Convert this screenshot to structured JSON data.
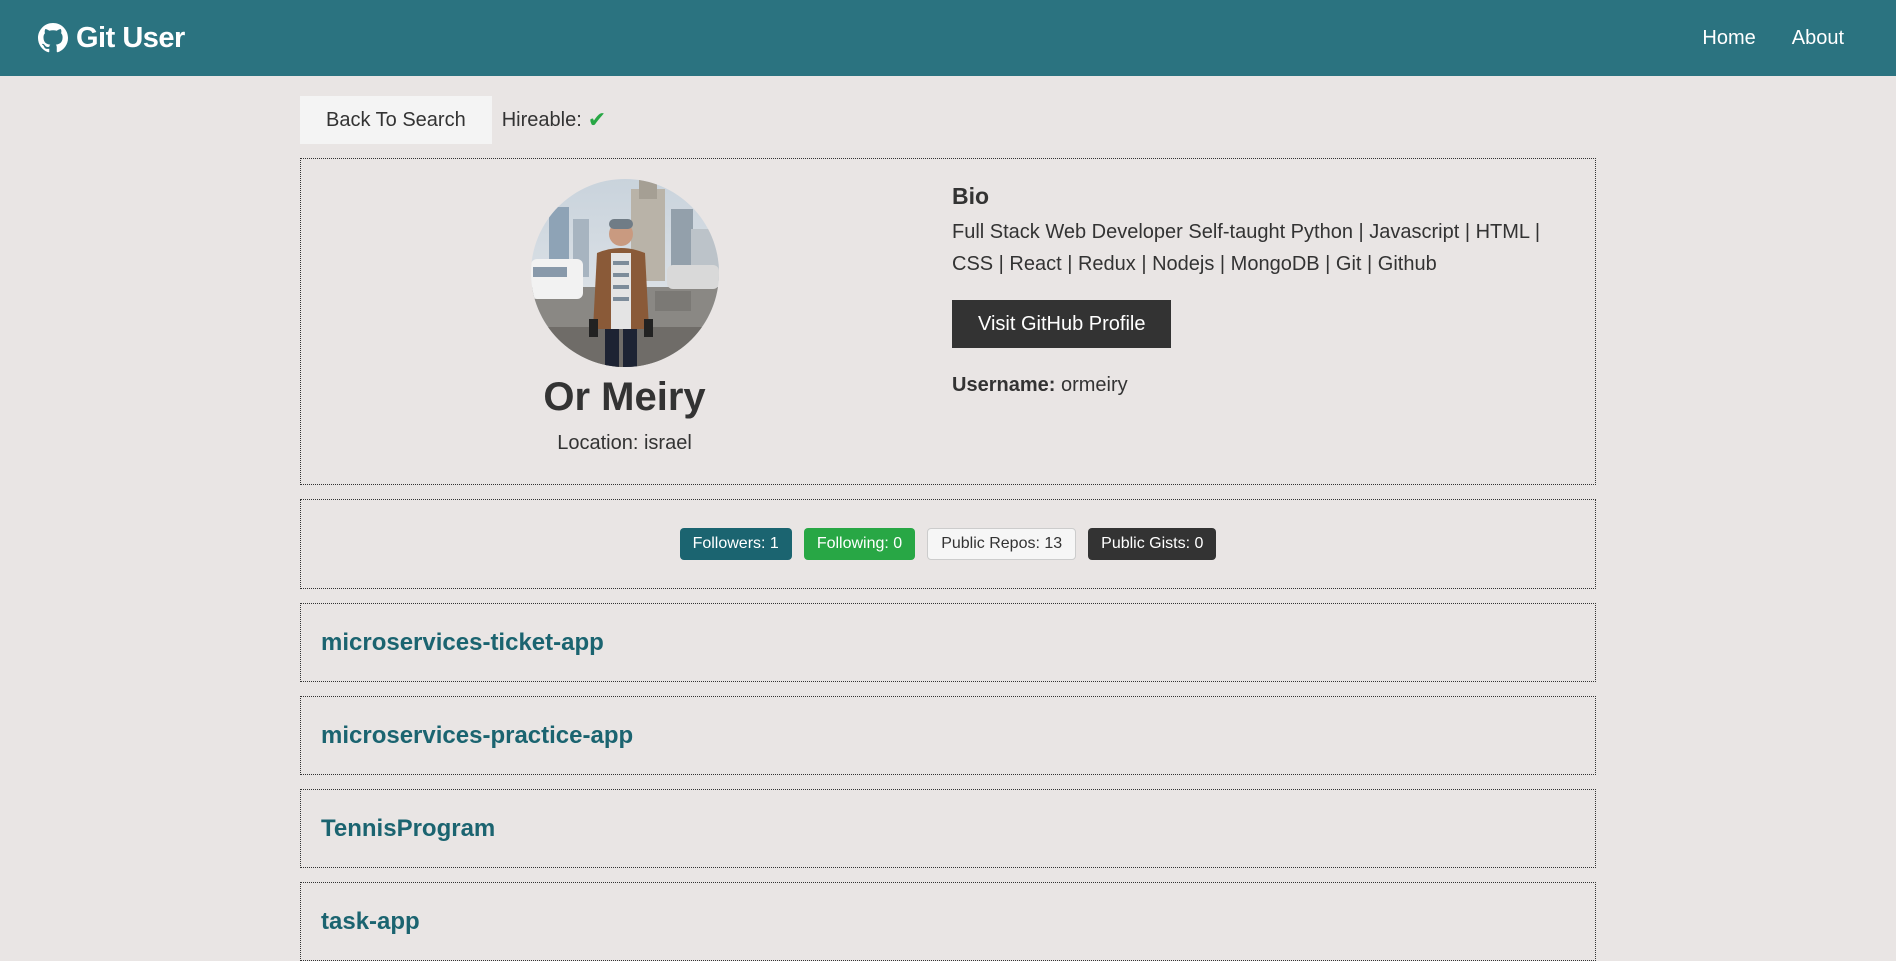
{
  "navbar": {
    "brand": "Git User",
    "links": [
      "Home",
      "About"
    ]
  },
  "top": {
    "back_label": "Back To Search",
    "hireable_label": "Hireable:"
  },
  "profile": {
    "name": "Or Meiry",
    "location": "Location: israel",
    "bio_title": "Bio",
    "bio": "Full Stack Web Developer Self-taught Python | Javascript | HTML | CSS | React | Redux | Nodejs | MongoDB | Git | Github",
    "visit_label": "Visit GitHub Profile",
    "username_label": "Username:",
    "username": "ormeiry"
  },
  "stats": {
    "followers": "Followers: 1",
    "following": "Following: 0",
    "public_repos": "Public Repos: 13",
    "public_gists": "Public Gists: 0"
  },
  "repos": [
    "microservices-ticket-app",
    "microservices-practice-app",
    "TennisProgram",
    "task-app"
  ],
  "colors": {
    "navbar": "#2b7380",
    "background": "#e9e5e4",
    "primary": "#1b6470",
    "success": "#28a745",
    "dark": "#333333"
  },
  "icons": {
    "brand": "github-icon",
    "hireable": "check-icon"
  }
}
